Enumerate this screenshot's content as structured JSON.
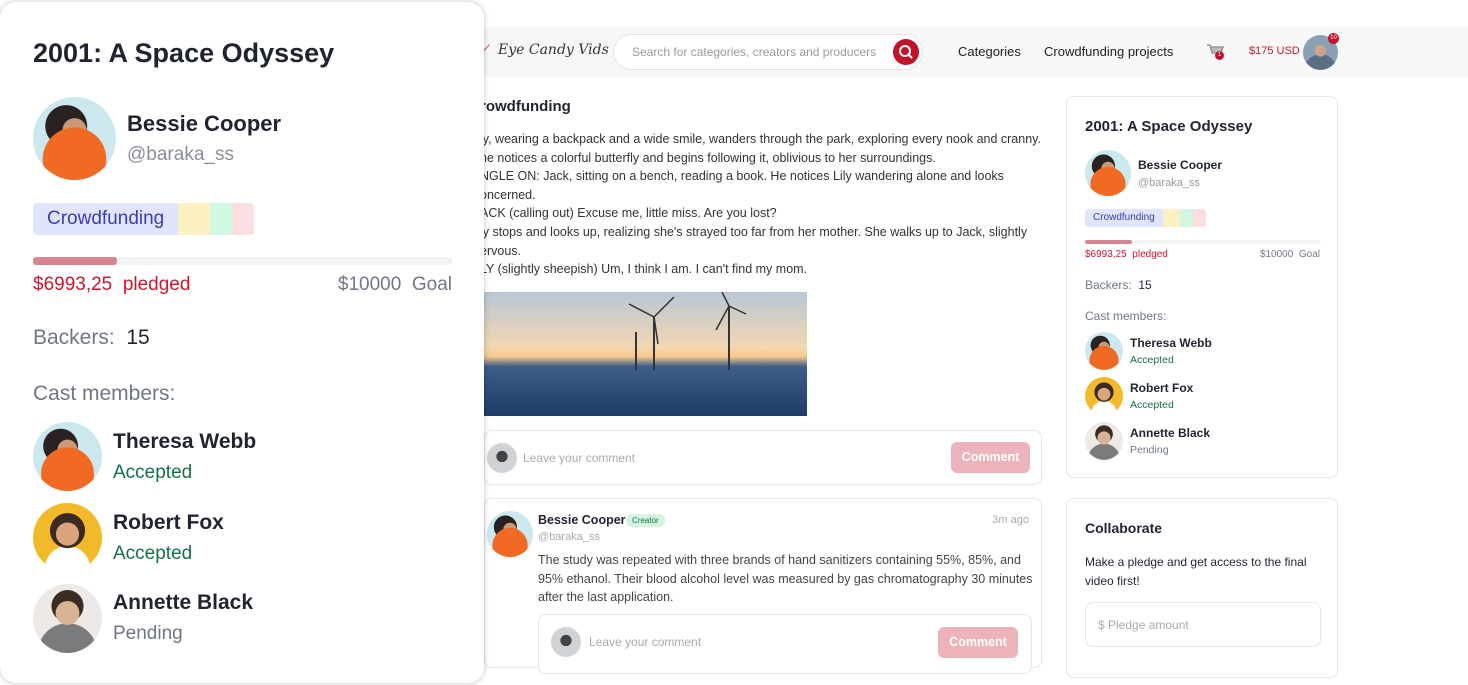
{
  "header": {
    "logo": "Eye Candy Vids",
    "search_placeholder": "Search for categories, creators and producers",
    "links": [
      "Categories",
      "Crowdfunding projects"
    ],
    "cart_count": "1",
    "balance": "$175 USD",
    "notif_count": "10"
  },
  "main": {
    "title": "rowdfunding",
    "lines": [
      "ly, wearing a backpack and a wide smile, wanders through the park, exploring every nook and cranny.",
      "ne notices a colorful butterfly and begins following it, oblivious to her surroundings.",
      "NGLE ON: Jack, sitting on a bench, reading a book. He notices Lily wandering alone and looks",
      "oncerned.",
      "ACK (calling out) Excuse me, little miss. Are you lost?",
      "ly stops and looks up, realizing she's strayed too far from her mother. She walks up to Jack, slightly",
      "ervous.",
      "LY (slightly sheepish) Um, I think I am. I can't find my mom."
    ],
    "comment_placeholder": "Leave your comment",
    "comment_button": "Comment",
    "comment": {
      "author": "Bessie Cooper",
      "badge": "Creator",
      "handle": "@baraka_ss",
      "time": "3m ago",
      "body": "The study was repeated with three brands of hand sanitizers containing 55%, 85%, and 95% ethanol. Their blood alcohol level was measured by gas chromatography 30 minutes after the last application.",
      "reply_placeholder": "Leave your comment",
      "reply_button": "Comment"
    }
  },
  "project": {
    "title": "2001: A Space Odyssey",
    "creator": "Bessie Cooper",
    "handle": "@baraka_ss",
    "tag": "Crowdfunding",
    "tag_colors": [
      "#e0e5fd",
      "#fdf1c4",
      "#d2f7e3",
      "#fbdfe0"
    ],
    "progress_percent": 20,
    "pledged": "$6993,25",
    "pledged_label": "pledged",
    "goal": "$10000",
    "goal_label": "Goal",
    "backers_label": "Backers:",
    "backers": "15",
    "cast_label": "Cast members:",
    "cast": [
      {
        "name": "Theresa Webb",
        "status": "Accepted"
      },
      {
        "name": "Robert Fox",
        "status": "Accepted"
      },
      {
        "name": "Annette Black",
        "status": "Pending"
      }
    ]
  },
  "collaborate": {
    "title": "Collaborate",
    "text": "Make a pledge and get access to the final video first!",
    "placeholder": "$ Pledge amount"
  },
  "colors": {
    "accent": "#c0142b",
    "accepted": "#187049",
    "pending": "#707784"
  }
}
